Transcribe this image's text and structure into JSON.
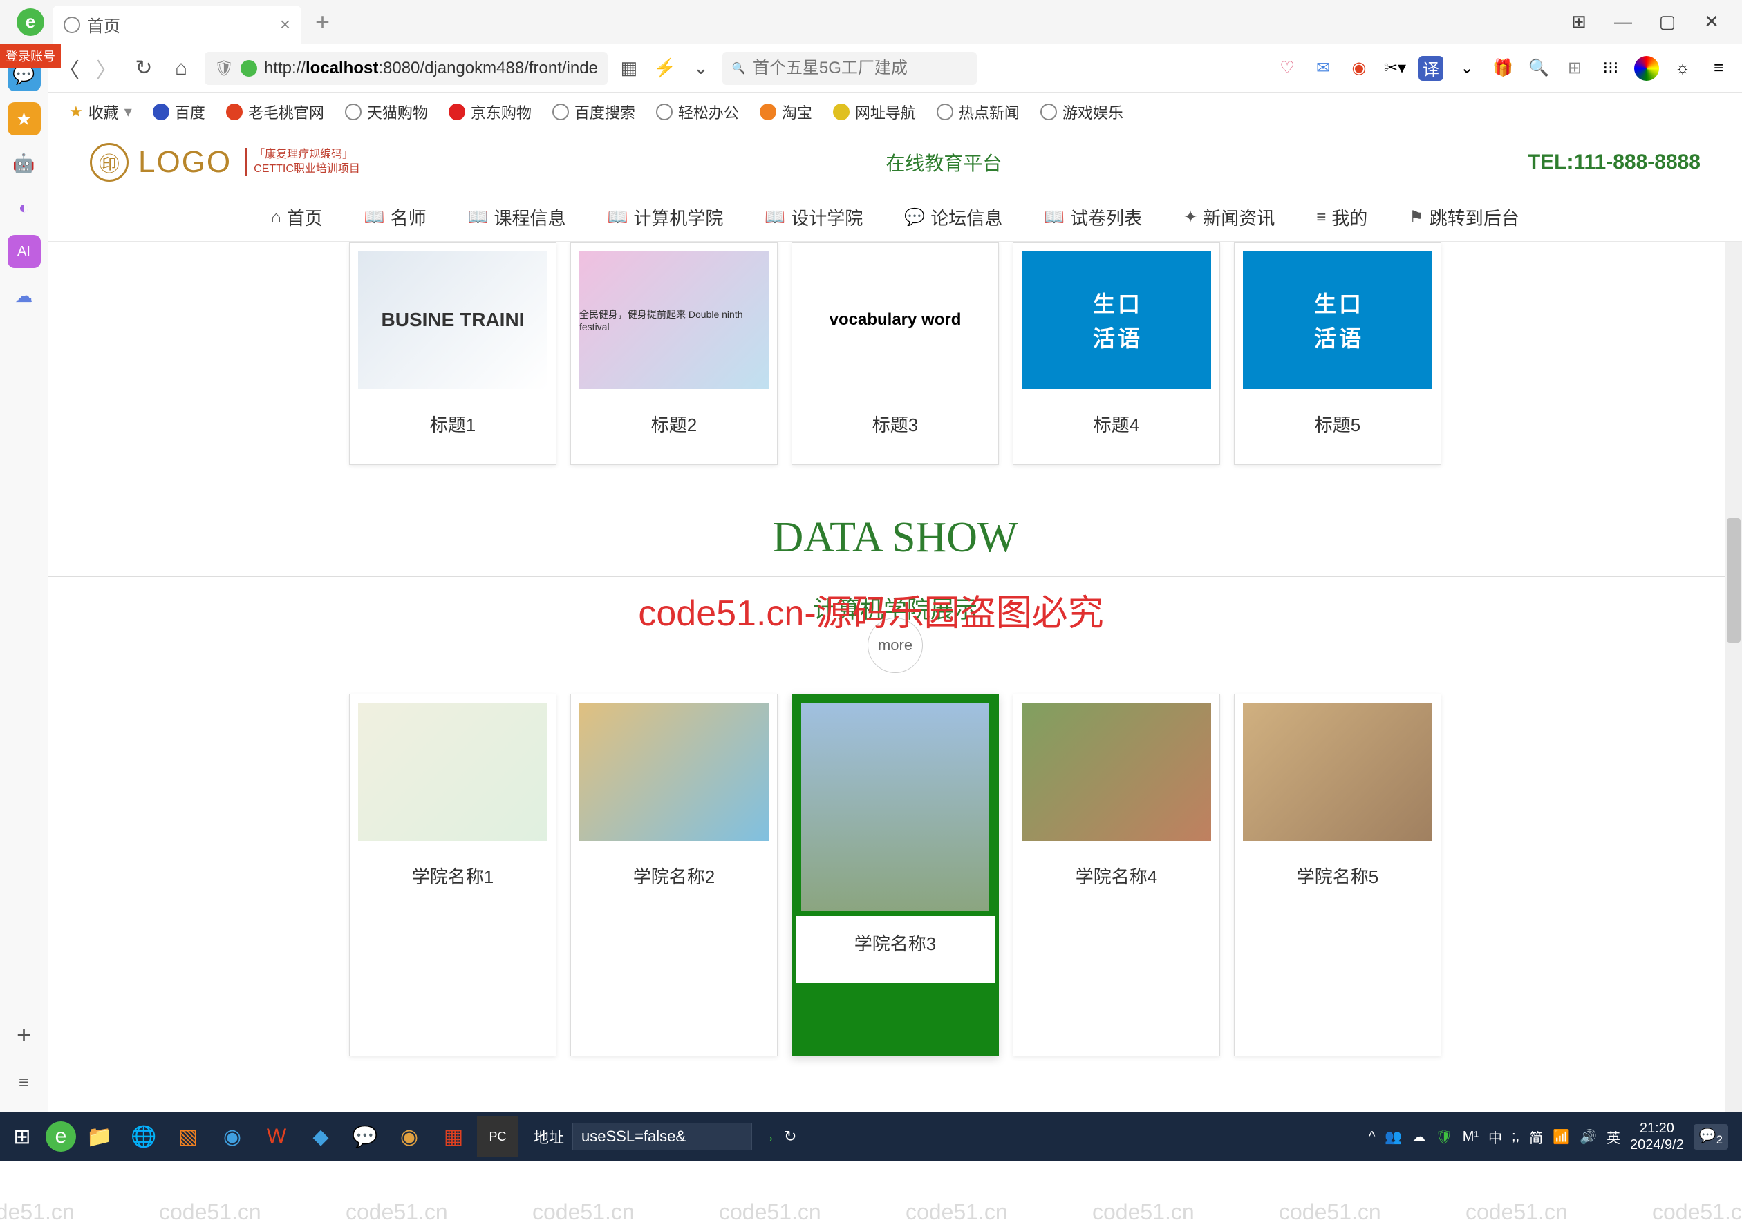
{
  "browser": {
    "tab_title": "首页",
    "url_prefix": "http://",
    "url_host": "localhost",
    "url_rest": ":8080/djangokm488/front/inde",
    "search_placeholder": "首个五星5G工厂建成",
    "login_badge": "登录账号"
  },
  "bookmarks": {
    "fav": "收藏",
    "items": [
      "百度",
      "老毛桃官网",
      "天猫购物",
      "京东购物",
      "百度搜索",
      "轻松办公",
      "淘宝",
      "网址导航",
      "热点新闻",
      "游戏娱乐"
    ]
  },
  "site": {
    "logo_text": "LOGO",
    "logo_sub1": "「康复理疗规编码」",
    "logo_sub2": "CETTIC职业培训项目",
    "platform": "在线教育平台",
    "tel": "TEL:111-888-8888",
    "nav": [
      "首页",
      "名师",
      "课程信息",
      "计算机学院",
      "设计学院",
      "论坛信息",
      "试卷列表",
      "新闻资讯",
      "我的",
      "跳转到后台"
    ]
  },
  "row1": {
    "cards": [
      {
        "title": "标题1",
        "img_hint": "BUSINE TRAINI"
      },
      {
        "title": "标题2",
        "img_hint": "全民健身，健身提前起来 Double ninth festival"
      },
      {
        "title": "标题3",
        "img_hint": "vocabulary word"
      },
      {
        "title": "标题4",
        "img_hint": "生活 口语"
      },
      {
        "title": "标题5",
        "img_hint": "生活 口语"
      }
    ]
  },
  "section": {
    "en": "DATA SHOW",
    "cn": "计算机学院展示",
    "more": "more"
  },
  "row2": {
    "cards": [
      {
        "title": "学院名称1"
      },
      {
        "title": "学院名称2"
      },
      {
        "title": "学院名称3"
      },
      {
        "title": "学院名称4"
      },
      {
        "title": "学院名称5"
      }
    ]
  },
  "watermark_text": "code51.cn",
  "watermark_red": "code51.cn-源码乐园盗图必究",
  "taskbar": {
    "addr_label": "地址",
    "addr_value": "useSSL=false&",
    "ime1": "M¹",
    "ime2": "中",
    "ime3": ";,",
    "ime4": "简",
    "ime5": "英",
    "time": "21:20",
    "date": "2024/9/2",
    "notif": "2"
  }
}
